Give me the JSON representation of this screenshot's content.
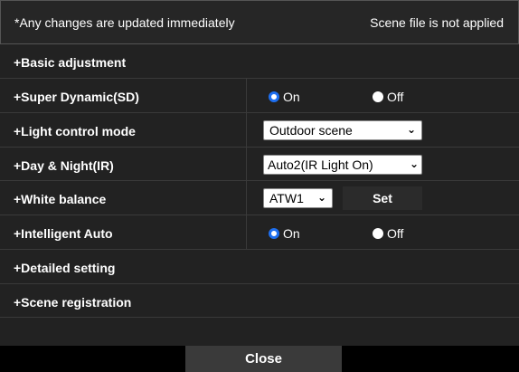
{
  "header": {
    "notice": "*Any changes are updated immediately",
    "status": "Scene file is not applied"
  },
  "rows": {
    "basic": "+Basic adjustment",
    "sd": "+Super Dynamic(SD)",
    "light": "+Light control mode",
    "daynight": "+Day & Night(IR)",
    "wb": "+White balance",
    "iauto": "+Intelligent Auto",
    "detailed": "+Detailed setting",
    "scene": "+Scene registration"
  },
  "radio": {
    "on": "On",
    "off": "Off"
  },
  "selects": {
    "light_value": "Outdoor scene",
    "daynight_value": "Auto2(IR Light On)",
    "wb_value": "ATW1"
  },
  "buttons": {
    "set": "Set",
    "close": "Close"
  },
  "state": {
    "sd": "On",
    "iauto": "On"
  },
  "colors": {
    "accent": "#1e6ff0",
    "background": "#222222"
  }
}
